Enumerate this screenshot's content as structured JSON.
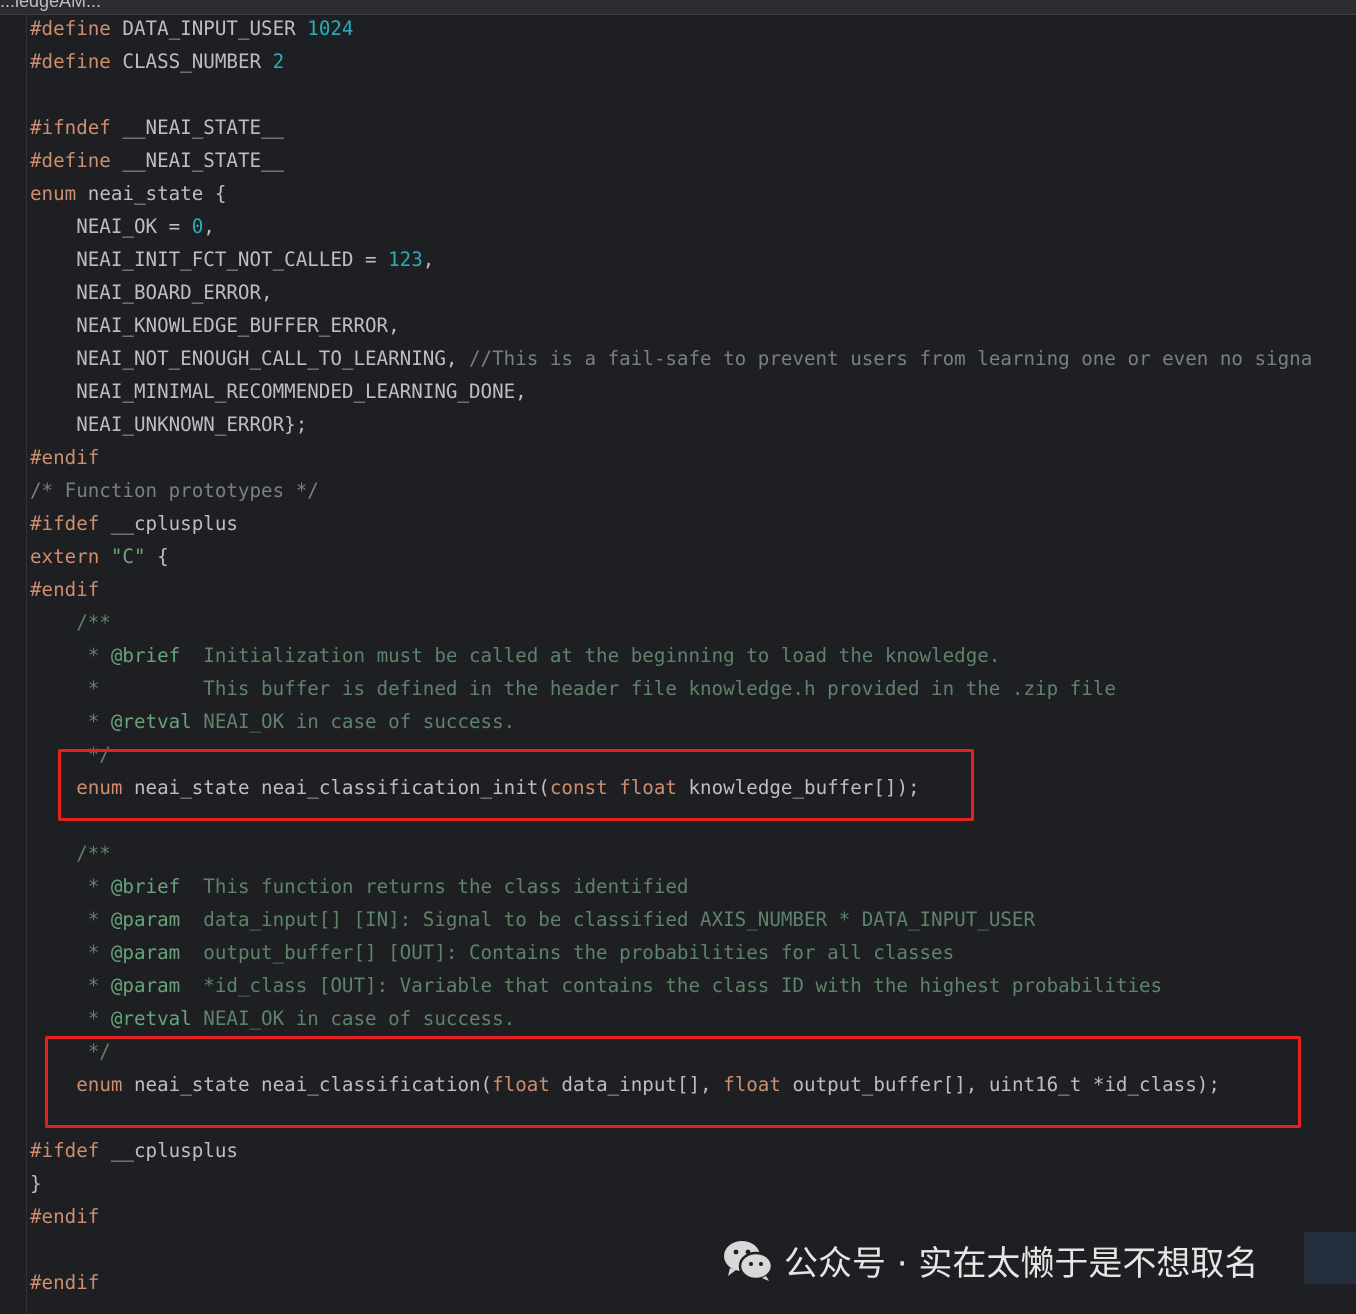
{
  "window": {
    "tab_title": "...ledgeAM..."
  },
  "code_lines": [
    [
      {
        "t": "#define",
        "c": "kw"
      },
      {
        "t": " DATA_INPUT_USER "
      },
      {
        "t": "1024",
        "c": "num"
      }
    ],
    [
      {
        "t": "#define",
        "c": "kw"
      },
      {
        "t": " CLASS_NUMBER "
      },
      {
        "t": "2",
        "c": "num"
      }
    ],
    [],
    [
      {
        "t": "#ifndef",
        "c": "kw"
      },
      {
        "t": " __NEAI_STATE__"
      }
    ],
    [
      {
        "t": "#define",
        "c": "kw"
      },
      {
        "t": " __NEAI_STATE__"
      }
    ],
    [
      {
        "t": "enum",
        "c": "kw"
      },
      {
        "t": " neai_state {"
      }
    ],
    [
      {
        "t": "    NEAI_OK = "
      },
      {
        "t": "0",
        "c": "num"
      },
      {
        "t": ","
      }
    ],
    [
      {
        "t": "    NEAI_INIT_FCT_NOT_CALLED = "
      },
      {
        "t": "123",
        "c": "num"
      },
      {
        "t": ","
      }
    ],
    [
      {
        "t": "    NEAI_BOARD_ERROR,"
      }
    ],
    [
      {
        "t": "    NEAI_KNOWLEDGE_BUFFER_ERROR,"
      }
    ],
    [
      {
        "t": "    NEAI_NOT_ENOUGH_CALL_TO_LEARNING, "
      },
      {
        "t": "//This is a fail-safe to prevent users from learning one or even no signa",
        "c": "cm"
      }
    ],
    [
      {
        "t": "    NEAI_MINIMAL_RECOMMENDED_LEARNING_DONE,"
      }
    ],
    [
      {
        "t": "    NEAI_UNKNOWN_ERROR};"
      }
    ],
    [
      {
        "t": "#endif",
        "c": "kw"
      }
    ],
    [
      {
        "t": "/* Function prototypes */",
        "c": "cm"
      }
    ],
    [
      {
        "t": "#ifdef",
        "c": "kw"
      },
      {
        "t": " __cplusplus"
      }
    ],
    [
      {
        "t": "extern",
        "c": "kw"
      },
      {
        "t": " "
      },
      {
        "t": "\"C\"",
        "c": "str"
      },
      {
        "t": " {"
      }
    ],
    [
      {
        "t": "#endif",
        "c": "kw"
      }
    ],
    [
      {
        "t": "    /**",
        "c": "doc"
      }
    ],
    [
      {
        "t": "     * ",
        "c": "doc"
      },
      {
        "t": "@brief",
        "c": "dtag"
      },
      {
        "t": "  Initialization must be called at the beginning to load the knowledge.",
        "c": "doc"
      }
    ],
    [
      {
        "t": "     *         This buffer is defined in the header file knowledge.h provided in the .zip file",
        "c": "doc"
      }
    ],
    [
      {
        "t": "     * ",
        "c": "doc"
      },
      {
        "t": "@retval",
        "c": "dtag"
      },
      {
        "t": " NEAI_OK in case of success.",
        "c": "doc"
      }
    ],
    [
      {
        "t": "     */",
        "c": "doc"
      }
    ],
    [
      {
        "t": "    "
      },
      {
        "t": "enum",
        "c": "kw"
      },
      {
        "t": " neai_state neai_classification_init("
      },
      {
        "t": "const",
        "c": "kw"
      },
      {
        "t": " "
      },
      {
        "t": "float",
        "c": "kw"
      },
      {
        "t": " knowledge_buffer[]);"
      }
    ],
    [],
    [
      {
        "t": "    /**",
        "c": "doc"
      }
    ],
    [
      {
        "t": "     * ",
        "c": "doc"
      },
      {
        "t": "@brief",
        "c": "dtag"
      },
      {
        "t": "  This function returns the class identified",
        "c": "doc"
      }
    ],
    [
      {
        "t": "     * ",
        "c": "doc"
      },
      {
        "t": "@param",
        "c": "dtag"
      },
      {
        "t": "  data_input[] [IN]: Signal to be classified AXIS_NUMBER * DATA_INPUT_USER",
        "c": "doc"
      }
    ],
    [
      {
        "t": "     * ",
        "c": "doc"
      },
      {
        "t": "@param",
        "c": "dtag"
      },
      {
        "t": "  output_buffer[] [OUT]: Contains the probabilities for all classes",
        "c": "doc"
      }
    ],
    [
      {
        "t": "     * ",
        "c": "doc"
      },
      {
        "t": "@param",
        "c": "dtag"
      },
      {
        "t": "  *id_class [OUT]: Variable that contains the class ID with the highest probabilities",
        "c": "doc"
      }
    ],
    [
      {
        "t": "     * ",
        "c": "doc"
      },
      {
        "t": "@retval",
        "c": "dtag"
      },
      {
        "t": " NEAI_OK in case of success.",
        "c": "doc"
      }
    ],
    [
      {
        "t": "     */",
        "c": "doc"
      }
    ],
    [
      {
        "t": "    "
      },
      {
        "t": "enum",
        "c": "kw"
      },
      {
        "t": " neai_state neai_classification("
      },
      {
        "t": "float",
        "c": "kw"
      },
      {
        "t": " data_input[], "
      },
      {
        "t": "float",
        "c": "kw"
      },
      {
        "t": " output_buffer[], uint16_t *id_class);"
      }
    ],
    [],
    [
      {
        "t": "#ifdef",
        "c": "kw"
      },
      {
        "t": " __cplusplus"
      }
    ],
    [
      {
        "t": "}"
      }
    ],
    [
      {
        "t": "#endif",
        "c": "kw"
      }
    ],
    [],
    [
      {
        "t": "#endif",
        "c": "kw"
      }
    ]
  ],
  "watermark": {
    "text": "公众号 · 实在太懒于是不想取名",
    "icon": "wechat-icon"
  },
  "colors": {
    "background": "#1e1f22",
    "keyword": "#cf8e6d",
    "number": "#2aacb8",
    "string": "#6aab73",
    "comment": "#7a7e85",
    "doc_comment": "#5f826b",
    "highlight_box": "#e3211f"
  }
}
